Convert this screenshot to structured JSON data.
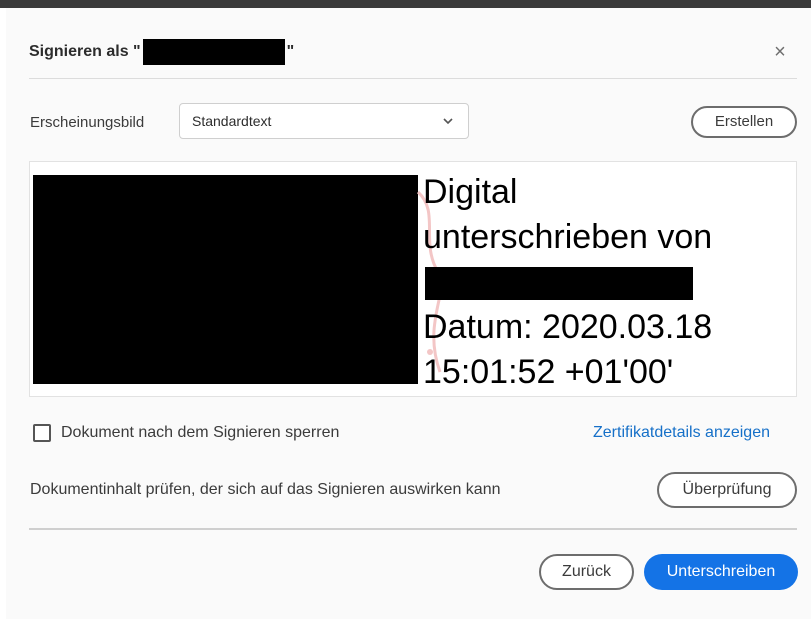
{
  "dialog": {
    "title_prefix": "Signieren als \"",
    "title_suffix": "\"",
    "close_glyph": "×"
  },
  "appearance": {
    "label": "Erscheinungsbild",
    "selected": "Standardtext",
    "create_label": "Erstellen"
  },
  "preview": {
    "line1": "Digital",
    "line2": "unterschrieben von",
    "line3": "Datum: 2020.03.18",
    "line4": "15:01:52 +01'00'"
  },
  "options": {
    "lock_label": "Dokument nach dem Signieren sperren",
    "lock_checked": false,
    "cert_link": "Zertifikatdetails anzeigen"
  },
  "review": {
    "text": "Dokumentinhalt prüfen, der sich auf das Signieren auswirken kann",
    "button": "Überprüfung"
  },
  "footer": {
    "back_label": "Zurück",
    "sign_label": "Unterschreiben"
  },
  "colors": {
    "accent": "#1473e6",
    "link": "#1670c8"
  }
}
